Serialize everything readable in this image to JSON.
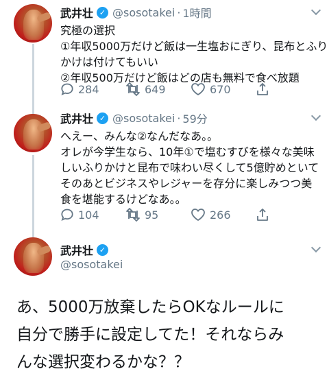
{
  "tweets": [
    {
      "name": "武井壮",
      "handle": "@sosotakei",
      "time": "1時間",
      "lines": [
        "究極の選択",
        "①年収5000万だけど飯は一生塩おにぎり、昆布とふり",
        "かけは付けてもいい",
        "②年収500万だけど飯はどの店も無料で食べ放題"
      ],
      "replies": "284",
      "retweets": "649",
      "likes": "670"
    },
    {
      "name": "武井壮",
      "handle": "@sosotakei",
      "time": "59分",
      "lines": [
        "へえー、みんな②なんだなあ。。",
        "オレが今学生なら、10年①で塩むすびを様々な美味",
        "しいふりかけと昆布で味わい尽くして5億貯めといて",
        "そのあとビジネスやレジャーを存分に楽しみつつ美",
        "食を堪能するけどなあ。。"
      ],
      "replies": "104",
      "retweets": "95",
      "likes": "266"
    }
  ],
  "main_tweet": {
    "name": "武井壮",
    "handle": "@sosotakei",
    "lines": [
      "あ、5000万放棄したらOKなルールに",
      "自分で勝手に設定してた！それならみ",
      "んな選択変わるかな？？"
    ]
  },
  "icons": {
    "verified": "verified-badge-icon",
    "reply": "reply-icon",
    "retweet": "retweet-icon",
    "like": "like-icon",
    "share": "share-icon",
    "more": "chevron-down-icon"
  },
  "colors": {
    "verified": "#1da1f2",
    "secondary_text": "#657786",
    "thread_line": "#ccd6dd"
  }
}
